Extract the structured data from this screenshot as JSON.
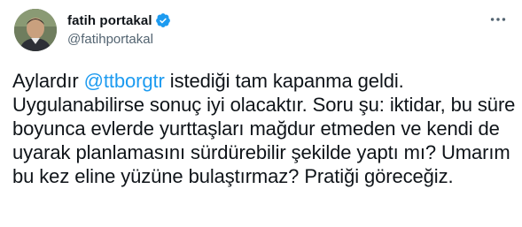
{
  "author": {
    "display_name": "fatih portakal",
    "handle": "@fatihportakal",
    "verified_icon": "verified-badge-icon",
    "avatar": "profile-photo"
  },
  "menu_icon": "more-horizontal-icon",
  "tweet": {
    "text_before_mention": "Aylardır ",
    "mention": "@ttborgtr",
    "text_after_mention": " istediği tam kapanma geldi. Uygulanabilirse sonuç iyi olacaktır. Soru şu: iktidar,  bu süre boyunca evlerde yurttaşları mağdur etmeden ve kendi de uyarak planlamasını sürdürebilir şekilde yaptı mı? Umarım bu kez eline yüzüne bulaştırmaz? Pratiği göreceğiz."
  },
  "colors": {
    "mention": "#1d9bf0",
    "verified": "#1d9bf0",
    "secondary_text": "#536471"
  }
}
